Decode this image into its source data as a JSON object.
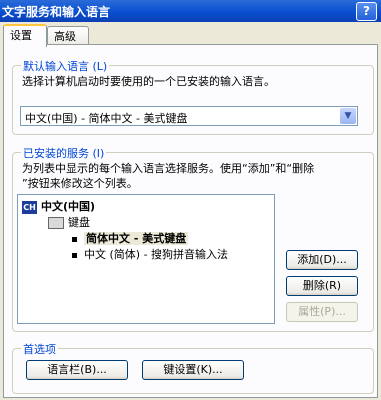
{
  "window": {
    "title": "文字服务和输入语言",
    "help_label": "?"
  },
  "tabs": [
    {
      "label": "设置",
      "active": true
    },
    {
      "label": "高级",
      "active": false
    }
  ],
  "default_language": {
    "group_label": "默认输入语言 (L)",
    "description": "选择计算机启动时要使用的一个已安装的输入语言。",
    "selected": "中文(中国) - 简体中文 - 美式键盘"
  },
  "installed_services": {
    "group_label": "已安装的服务 (I)",
    "description_line1": "为列表中显示的每个输入语言选择服务。使用“添加”和“删除",
    "description_line2": "”按钮来修改这个列表。",
    "tree": {
      "language": "中文(中国)",
      "language_badge": "CH",
      "category": "键盘",
      "items": [
        "简体中文 - 美式键盘",
        "中文 (简体) - 搜狗拼音输入法"
      ]
    },
    "buttons": {
      "add": "添加(D)...",
      "remove": "删除(R)",
      "properties": "属性(P)..."
    }
  },
  "preferences": {
    "group_label": "首选项",
    "language_bar": "语言栏(B)...",
    "key_settings": "键设置(K)..."
  }
}
